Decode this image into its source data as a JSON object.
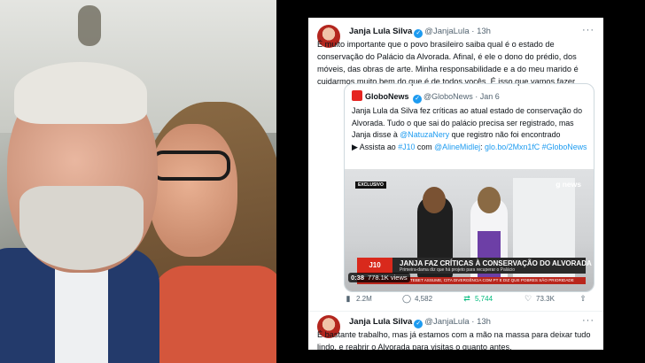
{
  "tweet1": {
    "name": "Janja Lula Silva",
    "handle": "@JanjaLula",
    "dot": "·",
    "time": "13h",
    "more": "···",
    "text": "É muito importante que o povo brasileiro saiba qual é o estado de conservação do Palácio da Alvorada. Afinal, é ele o dono do prédio, dos móveis, das obras de arte. Minha responsabilidade e a do meu marido é cuidarmos muito bem do que é de todos vocês. É isso que vamos fazer."
  },
  "quote": {
    "name": "GloboNews",
    "handle": "@GloboNews",
    "dot": "·",
    "date": "Jan 6",
    "text": "Janja Lula da Silva fez críticas ao atual estado de conservação do Alvorada. Tudo o que sai do palácio precisa ser registrado, mas Janja disse à ",
    "mention": "@NatuzaNery",
    "text2": " que registro não foi encontrado",
    "line3_prefix": "▶ Assista ao ",
    "hashtag1": "#J10",
    "line3_mid": " com ",
    "mention2": "@AlineMidlej",
    "line3_mid2": ": ",
    "link": "glo.bo/2Mxn1fC",
    "hashtag2": " #GloboNews"
  },
  "video": {
    "badge": "EXCLUSIVO",
    "brand": "g news",
    "program": "J10",
    "headline": "JANJA FAZ CRÍTICAS À CONSERVAÇÃO DO ALVORADA",
    "subheadline": "Primeira-dama diz que há projeto para recuperar o Palácio",
    "ticker": "TEBET ASSUME, CITA DIVERGÊNCIA COM PT E DIZ QUE POBRES SÃO PRIORIDADE",
    "duration": "0:38",
    "views": "778.1K views"
  },
  "actions": {
    "views": "2.2M",
    "replies": "4,582",
    "retweets": "5,744",
    "likes": "73.3K"
  },
  "tweet2": {
    "name": "Janja Lula Silva",
    "handle": "@JanjaLula",
    "dot": "·",
    "time": "13h",
    "more": "···",
    "text": "É bastante trabalho, mas já estamos com a mão na massa para deixar tudo lindo, e reabrir o Alvorada para visitas o quanto antes."
  },
  "colors": {
    "link": "#1d9bf0",
    "retweet_active": "#00ba7c",
    "globo_red": "#e52521"
  }
}
